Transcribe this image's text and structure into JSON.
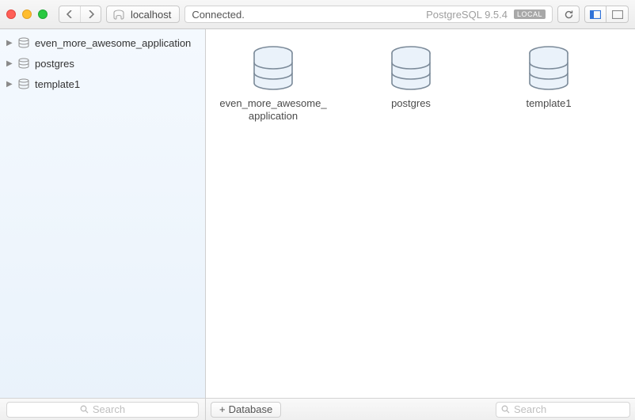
{
  "toolbar": {
    "host": "localhost",
    "status": "Connected.",
    "server": "PostgreSQL 9.5.4",
    "local_badge": "LOCAL"
  },
  "sidebar": {
    "items": [
      {
        "label": "even_more_awesome_application"
      },
      {
        "label": "postgres"
      },
      {
        "label": "template1"
      }
    ],
    "search_placeholder": "Search"
  },
  "main": {
    "databases": [
      {
        "label": "even_more_awesome_application"
      },
      {
        "label": "postgres"
      },
      {
        "label": "template1"
      }
    ]
  },
  "footer": {
    "add_db_label": "Database",
    "search_placeholder": "Search"
  }
}
